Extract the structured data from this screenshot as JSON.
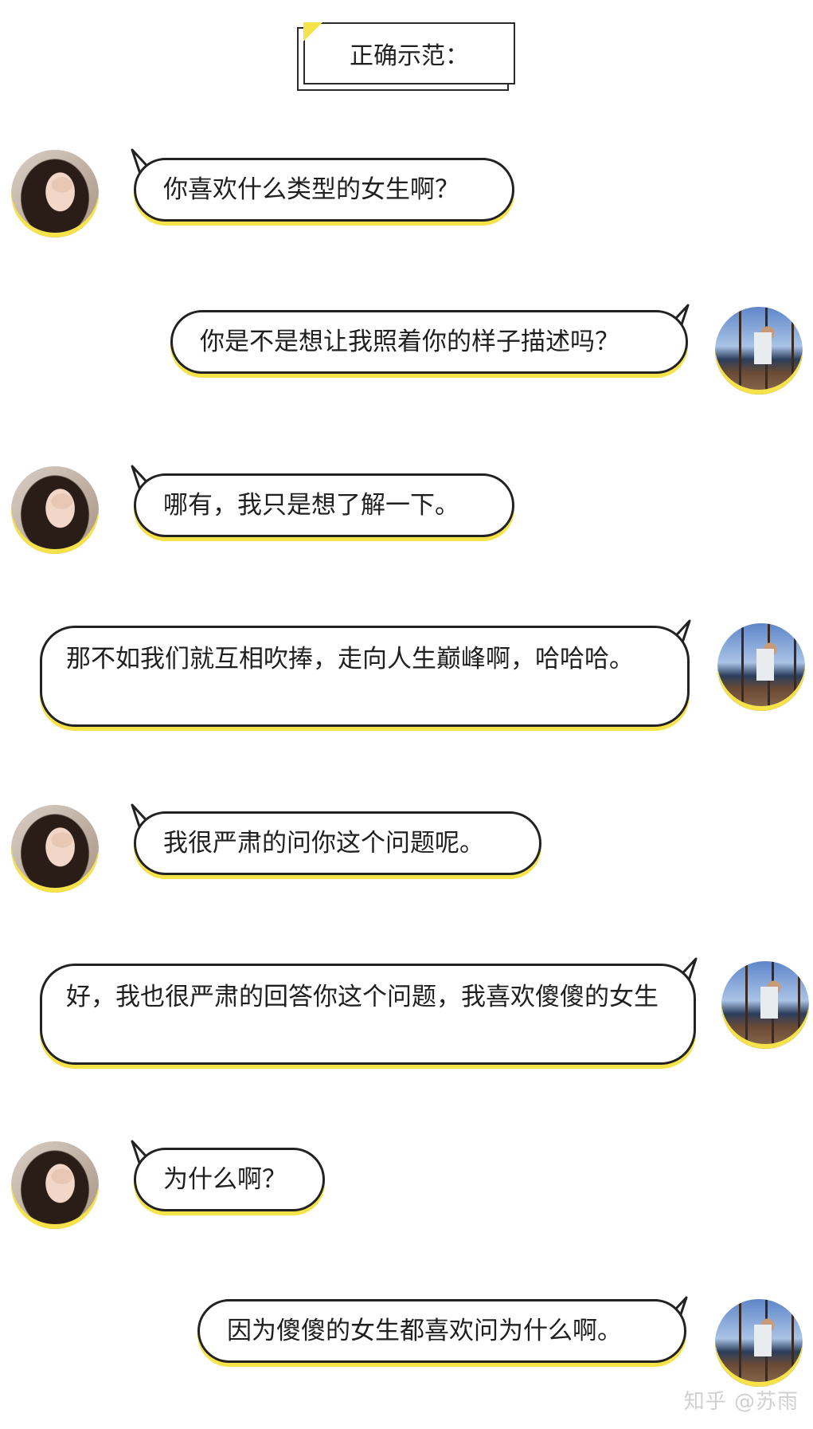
{
  "title": "正确示范：",
  "messages": [
    {
      "sender": "female",
      "text": "你喜欢什么类型的女生啊？"
    },
    {
      "sender": "male",
      "text": "你是不是想让我照着你的样子描述吗？"
    },
    {
      "sender": "female",
      "text": "哪有，我只是想了解一下。"
    },
    {
      "sender": "male",
      "text": "那不如我们就互相吹捧，走向人生巅峰啊，哈哈哈。"
    },
    {
      "sender": "female",
      "text": "我很严肃的问你这个问题呢。"
    },
    {
      "sender": "male",
      "text": "好，我也很严肃的回答你这个问题，我喜欢傻傻的女生"
    },
    {
      "sender": "female",
      "text": "为什么啊？"
    },
    {
      "sender": "male",
      "text": "因为傻傻的女生都喜欢问为什么啊。"
    }
  ],
  "watermark": "知乎 @苏雨",
  "colors": {
    "accent": "#f6e34a",
    "border": "#222222"
  }
}
